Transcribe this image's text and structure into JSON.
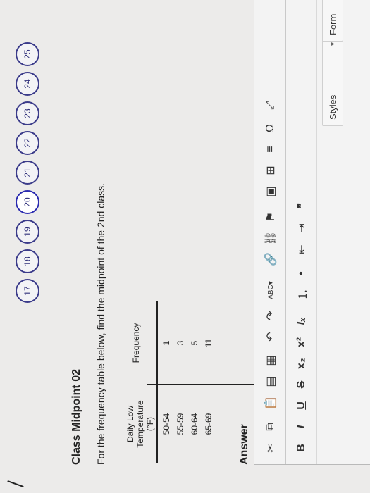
{
  "nav": {
    "left_text": "",
    "bubbles": [
      "17",
      "18",
      "19",
      "20",
      "21",
      "22",
      "23",
      "24",
      "25"
    ]
  },
  "question": {
    "title": "Class Midpoint 02",
    "instruction": "For the frequency table below, find the midpoint of the 2nd class."
  },
  "table": {
    "col1_header_line1": "Daily Low Temperature",
    "col1_header_line2": "(°F)",
    "col2_header": "Frequency",
    "rows": [
      {
        "range": "50-54",
        "freq": "1"
      },
      {
        "range": "55-59",
        "freq": "3"
      },
      {
        "range": "60-64",
        "freq": "5"
      },
      {
        "range": "65-69",
        "freq": "11"
      }
    ]
  },
  "answer": {
    "label": "Answer"
  },
  "editor": {
    "styles_label": "Styles",
    "format_label": "Form"
  }
}
